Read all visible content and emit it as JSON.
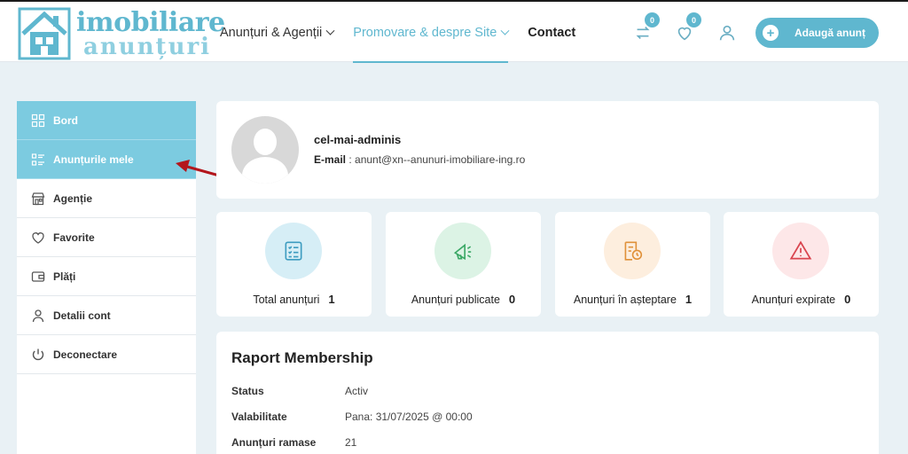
{
  "logo": {
    "line1": "imobiliare",
    "line2": "anunțuri"
  },
  "nav": [
    {
      "label": "Anunțuri & Agenții",
      "dropdown": true,
      "active": false
    },
    {
      "label": "Promovare & despre Site",
      "dropdown": true,
      "active": true
    },
    {
      "label": "Contact",
      "dropdown": false,
      "active": false
    }
  ],
  "header": {
    "compare_count": "0",
    "favorites_count": "0",
    "add_button": "Adaugă anunț"
  },
  "sidebar": {
    "items": [
      {
        "label": "Bord",
        "icon": "dashboard-icon",
        "active": true
      },
      {
        "label": "Anunțurile mele",
        "icon": "list-icon",
        "active": true
      },
      {
        "label": "Agenție",
        "icon": "store-icon",
        "active": false
      },
      {
        "label": "Favorite",
        "icon": "heart-icon",
        "active": false
      },
      {
        "label": "Plăți",
        "icon": "wallet-icon",
        "active": false
      },
      {
        "label": "Detalii cont",
        "icon": "user-icon",
        "active": false
      },
      {
        "label": "Deconectare",
        "icon": "power-icon",
        "active": false
      }
    ]
  },
  "profile": {
    "username": "cel-mai-adminis",
    "email_label": "E-mail",
    "email_value": " : anunt@xn--anunuri-imobiliare-ing.ro"
  },
  "stats": [
    {
      "label": "Total anunțuri",
      "value": "1",
      "icon": "checklist-icon",
      "bg": "#d6eef6",
      "color": "#3d9cc0"
    },
    {
      "label": "Anunțuri publicate",
      "value": "0",
      "icon": "megaphone-icon",
      "bg": "#dcf3e5",
      "color": "#3ba866"
    },
    {
      "label": "Anunțuri în așteptare",
      "value": "1",
      "icon": "pending-icon",
      "bg": "#fdeede",
      "color": "#e0913a"
    },
    {
      "label": "Anunțuri expirate",
      "value": "0",
      "icon": "warning-icon",
      "bg": "#fde7e8",
      "color": "#d9454f"
    }
  ],
  "report": {
    "title": "Raport Membership",
    "rows": [
      {
        "key": "Status",
        "value": "Activ"
      },
      {
        "key": "Valabilitate",
        "value": "Pana: 31/07/2025 @ 00:00"
      },
      {
        "key": "Anunțuri ramase",
        "value": "21"
      }
    ]
  },
  "colors": {
    "accent": "#5fb7cf",
    "sidebar_active": "#7ccbe0",
    "arrow": "#b3161c"
  }
}
